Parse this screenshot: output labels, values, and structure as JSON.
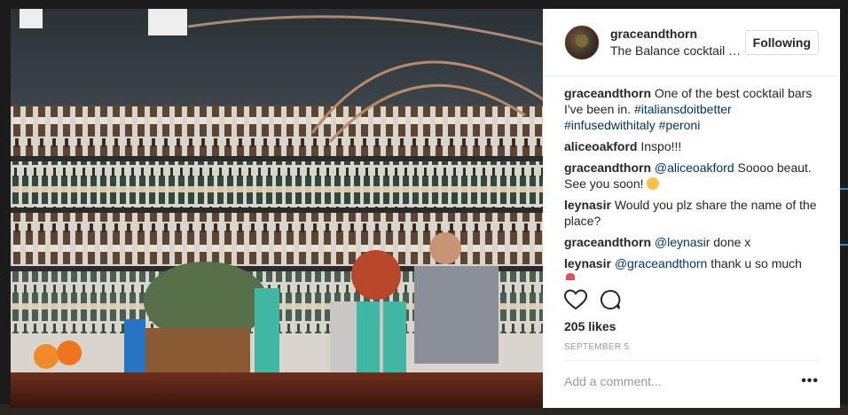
{
  "post": {
    "username": "graceandthorn",
    "location": "The Balance cocktail bar",
    "follow_label": "Following",
    "likes": "205 likes",
    "date": "SEPTEMBER 5",
    "comment_placeholder": "Add a comment...",
    "more_label": "•••"
  },
  "comments": [
    {
      "user": "graceandthorn",
      "parts": [
        {
          "t": "text",
          "v": " One of the best cocktail bars I've been in. "
        },
        {
          "t": "tag",
          "v": "#italiansdoitbetter"
        },
        {
          "t": "text",
          "v": " "
        },
        {
          "t": "tag",
          "v": "#infusedwithitaly"
        },
        {
          "t": "text",
          "v": " "
        },
        {
          "t": "tag",
          "v": "#peroni"
        }
      ]
    },
    {
      "user": "aliceoakford",
      "parts": [
        {
          "t": "text",
          "v": " Inspo!!!"
        }
      ]
    },
    {
      "user": "graceandthorn",
      "parts": [
        {
          "t": "text",
          "v": " "
        },
        {
          "t": "tag",
          "v": "@aliceoakford"
        },
        {
          "t": "text",
          "v": " Soooo beaut. See you soon! "
        },
        {
          "t": "emoji",
          "v": ""
        }
      ]
    },
    {
      "user": "leynasir",
      "parts": [
        {
          "t": "text",
          "v": " Would you plz share the name of the place?"
        }
      ]
    },
    {
      "user": "graceandthorn",
      "parts": [
        {
          "t": "text",
          "v": " "
        },
        {
          "t": "tag",
          "v": "@leynasir"
        },
        {
          "t": "text",
          "v": " done x"
        }
      ]
    },
    {
      "user": "leynasir",
      "parts": [
        {
          "t": "text",
          "v": " "
        },
        {
          "t": "tag",
          "v": "@graceandthorn"
        },
        {
          "t": "text",
          "v": " thank u so much"
        }
      ]
    }
  ],
  "icons": {
    "like": "heart-icon",
    "comment": "comment-icon",
    "more": "more-options-icon"
  },
  "colors": {
    "text": "#262626",
    "link": "#003569",
    "muted": "#999999",
    "border": "#dbdbdb"
  }
}
